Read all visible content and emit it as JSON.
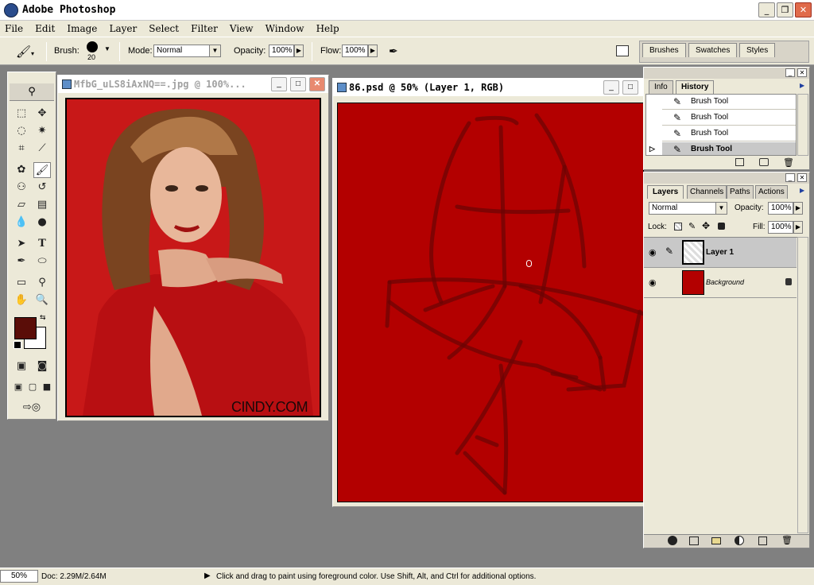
{
  "app": {
    "title": "Adobe Photoshop"
  },
  "menu": [
    "File",
    "Edit",
    "Image",
    "Layer",
    "Select",
    "Filter",
    "View",
    "Window",
    "Help"
  ],
  "options": {
    "brush_label": "Brush:",
    "brush_size": "20",
    "mode_label": "Mode:",
    "mode_value": "Normal",
    "opacity_label": "Opacity:",
    "opacity_value": "100%",
    "flow_label": "Flow:",
    "flow_value": "100%"
  },
  "palette_well": {
    "tabs": [
      "Brushes",
      "Swatches",
      "Styles"
    ]
  },
  "colors": {
    "foreground": "#5a0d08",
    "background": "#ffffff",
    "canvas": "#b30000",
    "photo_bg": "#c81818"
  },
  "doc1": {
    "title": "MfbG_uLS8iAxNQ==.jpg @ 100%...",
    "watermark": "CINDY.COM"
  },
  "doc2": {
    "title": "86.psd @ 50% (Layer 1, RGB)"
  },
  "history_panel": {
    "tabs": [
      "Info",
      "History"
    ],
    "items": [
      "Brush Tool",
      "Brush Tool",
      "Brush Tool",
      "Brush Tool"
    ]
  },
  "layers_panel": {
    "tabs": [
      "Layers",
      "Channels",
      "Paths",
      "Actions"
    ],
    "blend_mode": "Normal",
    "opacity_label": "Opacity:",
    "opacity_value": "100%",
    "lock_label": "Lock:",
    "fill_label": "Fill:",
    "fill_value": "100%",
    "layers": [
      {
        "name": "Layer 1"
      },
      {
        "name": "Background"
      }
    ]
  },
  "status": {
    "zoom": "50%",
    "doc": "Doc: 2.29M/2.64M",
    "hint": "Click and drag to paint using foreground color.  Use Shift, Alt, and Ctrl for additional options."
  }
}
